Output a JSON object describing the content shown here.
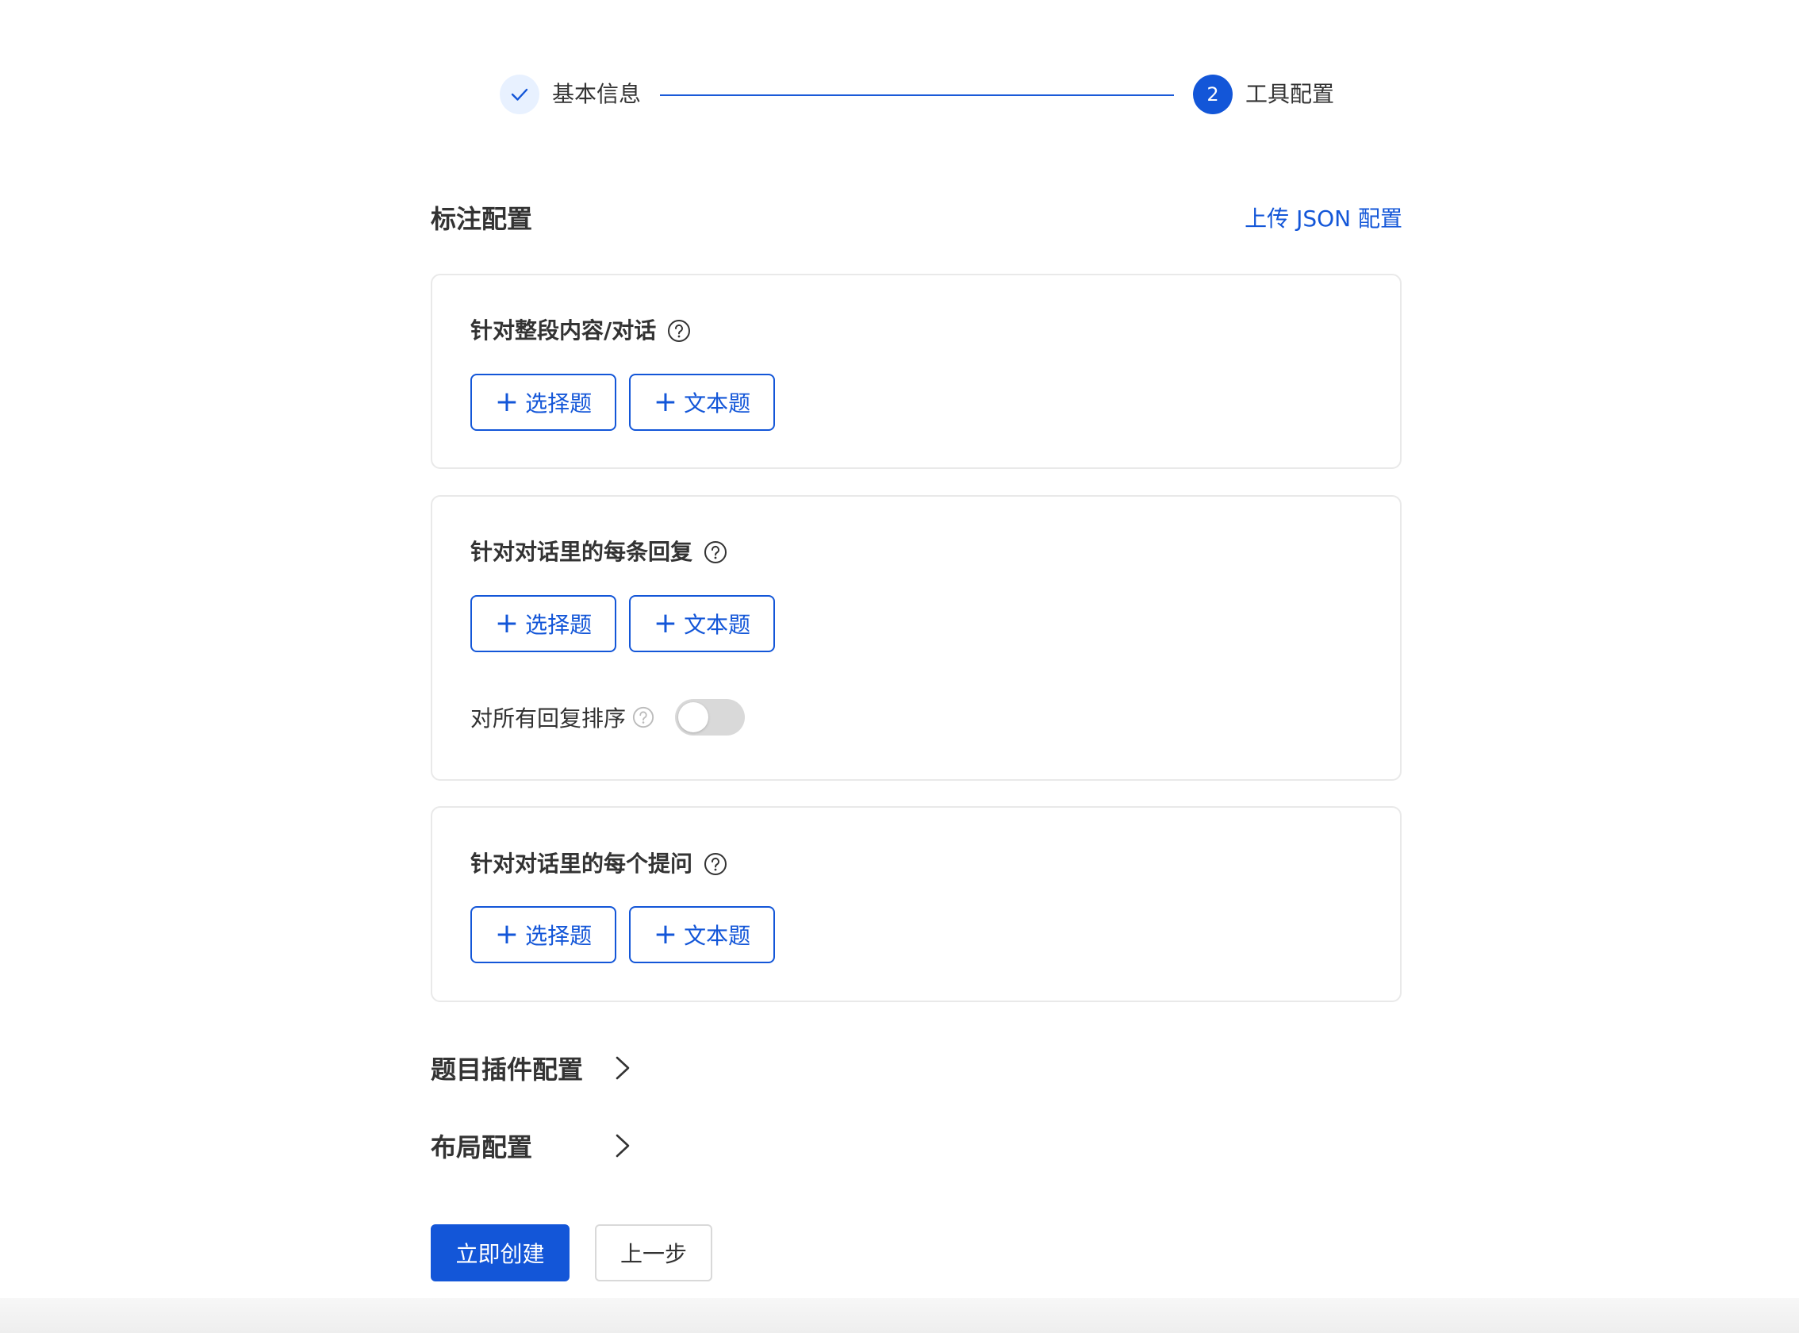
{
  "steps": {
    "step1": {
      "label": "基本信息",
      "status": "done"
    },
    "step2": {
      "number": "2",
      "label": "工具配置",
      "status": "active"
    }
  },
  "header": {
    "title": "标注配置",
    "upload_link": "上传 JSON 配置"
  },
  "cards": [
    {
      "title": "针对整段内容/对话",
      "buttons": [
        "选择题",
        "文本题"
      ]
    },
    {
      "title": "针对对话里的每条回复",
      "buttons": [
        "选择题",
        "文本题"
      ],
      "toggle": {
        "label": "对所有回复排序",
        "on": false
      }
    },
    {
      "title": "针对对话里的每个提问",
      "buttons": [
        "选择题",
        "文本题"
      ]
    }
  ],
  "collapsibles": [
    {
      "title": "题目插件配置"
    },
    {
      "title": "布局配置"
    }
  ],
  "footer": {
    "create_label": "立即创建",
    "prev_label": "上一步"
  },
  "colors": {
    "primary": "#1356d8",
    "text": "#333333",
    "border": "#e9e9e9"
  }
}
